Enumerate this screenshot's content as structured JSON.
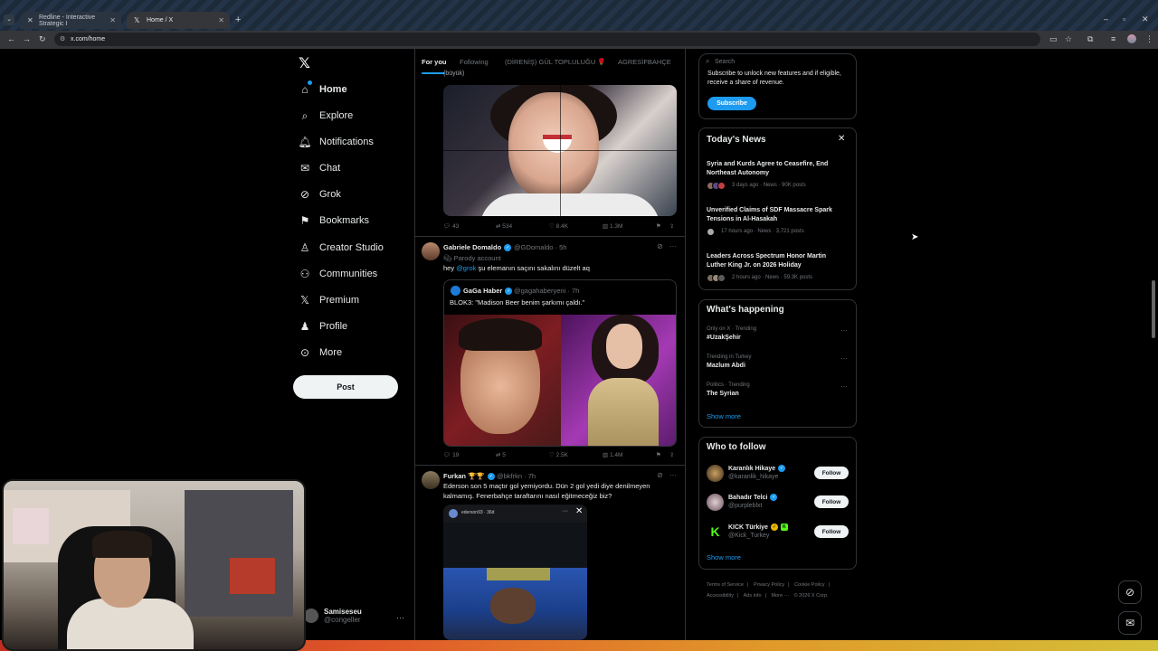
{
  "browser": {
    "tabs": [
      {
        "title": "Redline - Interactive Strategic I"
      },
      {
        "title": "Home / X"
      }
    ],
    "url": "x.com/home"
  },
  "nav": {
    "items": [
      {
        "label": "Home",
        "icon": "home-icon"
      },
      {
        "label": "Explore",
        "icon": "search-icon"
      },
      {
        "label": "Notifications",
        "icon": "bell-icon"
      },
      {
        "label": "Chat",
        "icon": "mail-icon"
      },
      {
        "label": "Grok",
        "icon": "grok-icon"
      },
      {
        "label": "Bookmarks",
        "icon": "bookmark-icon"
      },
      {
        "label": "Creator Studio",
        "icon": "creator-icon"
      },
      {
        "label": "Communities",
        "icon": "people-icon"
      },
      {
        "label": "Premium",
        "icon": "x-icon"
      },
      {
        "label": "Profile",
        "icon": "person-icon"
      },
      {
        "label": "More",
        "icon": "more-circle-icon"
      }
    ],
    "post_label": "Post",
    "account": {
      "name": "Samiseseu",
      "handle": "@congeller"
    }
  },
  "feed_tabs": [
    "For you",
    "Following",
    "(DİRENİŞ) GÜL TOPLULUĞU 🌹",
    "AGRESİFBAHÇE"
  ],
  "posts": [
    {
      "cut_text": "(büyük)",
      "stats": {
        "replies": "43",
        "reposts": "534",
        "likes": "8.4K",
        "views": "1.3M"
      }
    },
    {
      "name": "Gabriele Domaldo",
      "handle": "@GDomaldo · 5h",
      "sub": "Parody account",
      "text_prefix": "hey ",
      "mention": "@grok",
      "text_suffix": " şu elemanın saçını sakalını düzelt aq",
      "quote": {
        "name": "GaGa Haber",
        "handle": "@gagahaberyeni · 7h",
        "text": "BLOK3: \"Madison Beer benim şarkımı çaldı.\""
      },
      "stats": {
        "replies": "19",
        "reposts": "5",
        "likes": "2.5K",
        "views": "1.4M"
      }
    },
    {
      "name": "Furkan 🏆🏆",
      "handle": "@bkfrkn · 7h",
      "text": "Ederson son 5 maçtır gol yemiyordu. Dün 2 gol yedi diye denilmeyen kalmamış. Fenerbahçe taraftarını nasıl eğitmeceğiz biz?",
      "embed": {
        "handle": "ederson93",
        "time": "36d"
      }
    }
  ],
  "right": {
    "search_placeholder": "Search",
    "subscribe_text": "Subscribe to unlock new features and if eligible, receive a share of revenue.",
    "subscribe_label": "Subscribe",
    "news_title": "Today's News",
    "news": [
      {
        "headline": "Syria and Kurds Agree to Ceasefire, End Northeast Autonomy",
        "meta": "3 days ago · News · 90K posts"
      },
      {
        "headline": "Unverified Claims of SDF Massacre Spark Tensions in Al-Hasakah",
        "meta": "17 hours ago · News · 3,721 posts"
      },
      {
        "headline": "Leaders Across Spectrum Honor Martin Luther King Jr. on 2026 Holiday",
        "meta": "2 hours ago · News · 59.3K posts"
      }
    ],
    "happening_title": "What's happening",
    "trends": [
      {
        "context": "Only on X · Trending",
        "name": "#UzakŞehir"
      },
      {
        "context": "Trending in Turkey",
        "name": "Mazlum Abdi"
      },
      {
        "context": "Politics · Trending",
        "name": "The Syrian"
      }
    ],
    "show_more": "Show more",
    "follow_title": "Who to follow",
    "follow": [
      {
        "name": "Karanlık Hikaye",
        "handle": "@karanlik_hikaye"
      },
      {
        "name": "Bahadır Telci",
        "handle": "@purpleblxt"
      },
      {
        "name": "KICK Türkiye",
        "handle": "@Kick_Turkey"
      }
    ],
    "follow_label": "Follow",
    "footer": [
      "Terms of Service",
      "|",
      "Privacy Policy",
      "|",
      "Cookie Policy",
      "|",
      "Accessibility",
      "|",
      "Ads info",
      "|",
      "More ···",
      "© 2026 X Corp."
    ]
  },
  "colors": {
    "accent": "#1d9bf0",
    "background": "#000000",
    "text": "#e7e9ea",
    "muted": "#71767b"
  }
}
